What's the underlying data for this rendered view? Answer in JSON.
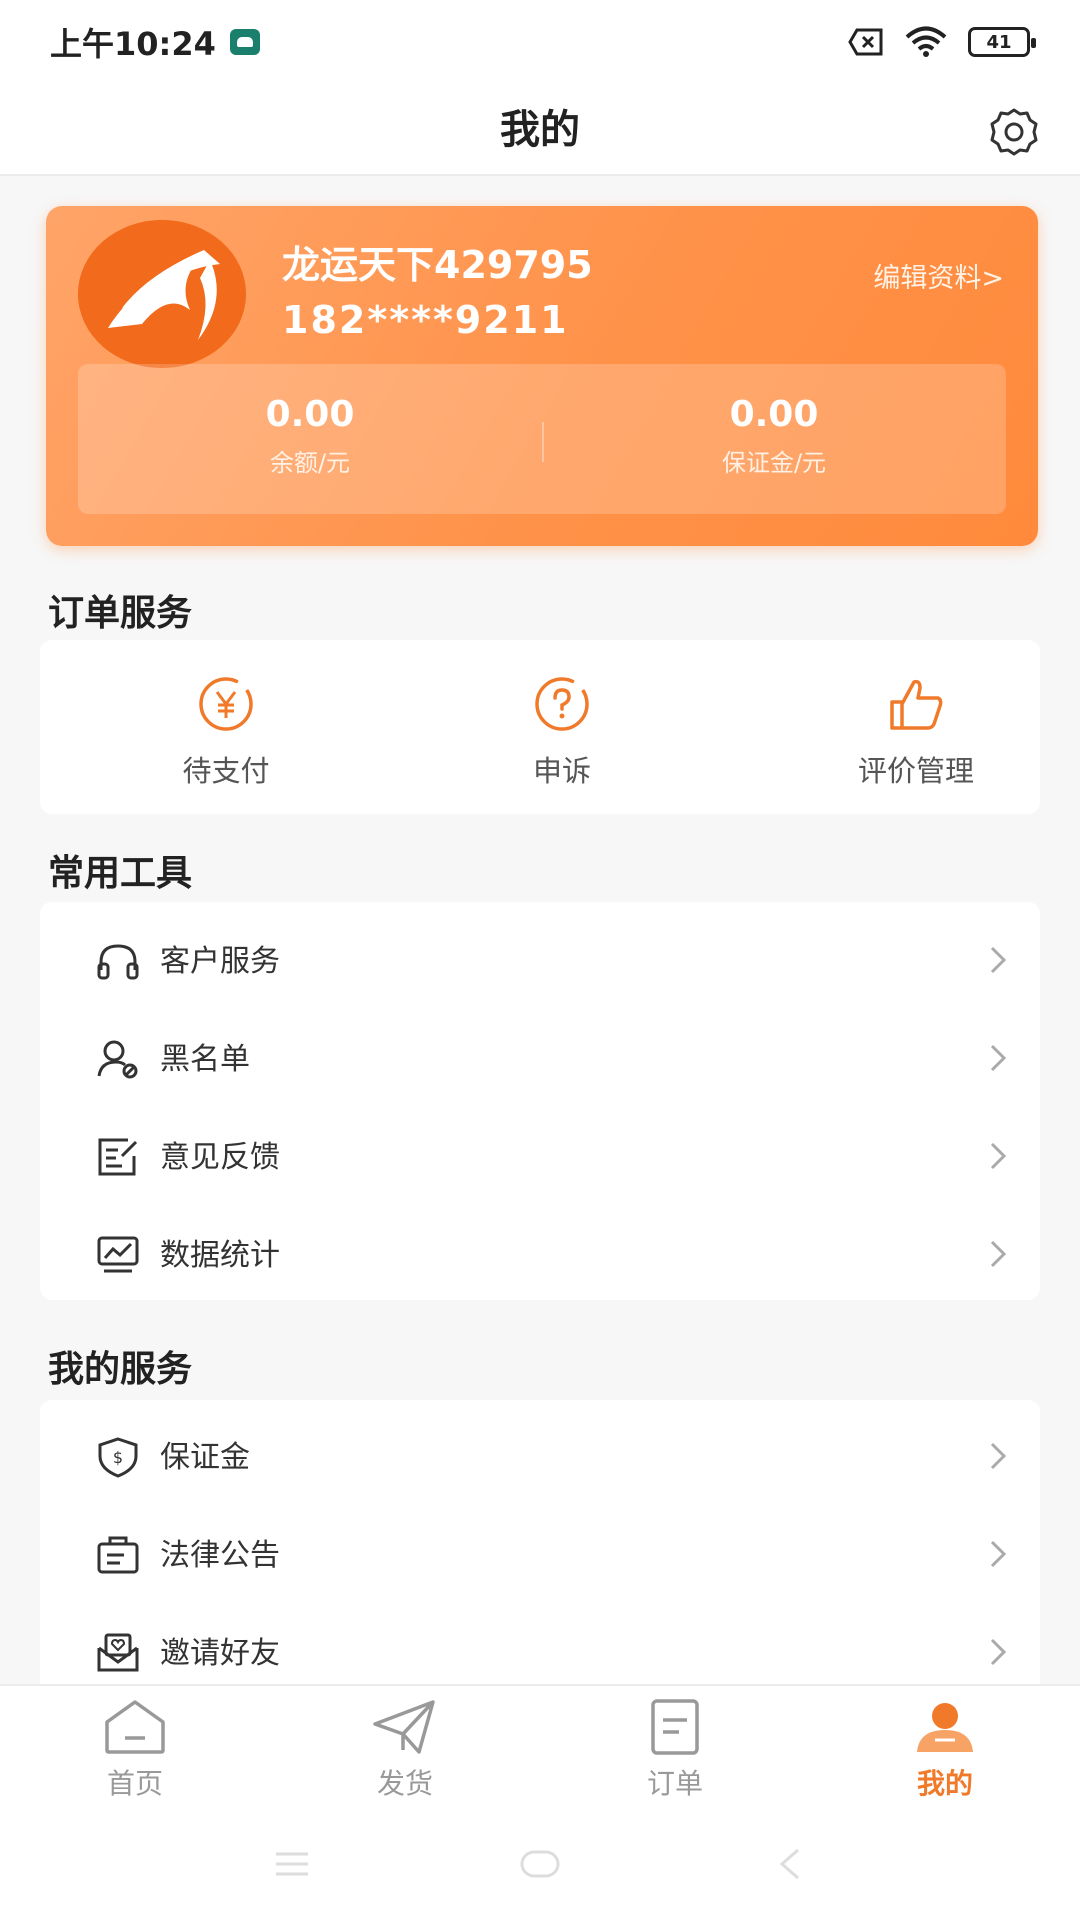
{
  "status_bar": {
    "time": "上午10:24",
    "battery": "41"
  },
  "header": {
    "title": "我的"
  },
  "profile": {
    "name": "龙运天下429795",
    "phone": "182****9211",
    "edit_label": "编辑资料>",
    "balance": {
      "value": "0.00",
      "label": "余额/元"
    },
    "deposit": {
      "value": "0.00",
      "label": "保证金/元"
    }
  },
  "order_service": {
    "title": "订单服务",
    "items": [
      {
        "label": "待支付",
        "icon": "yen-icon"
      },
      {
        "label": "申诉",
        "icon": "question-icon"
      },
      {
        "label": "评价管理",
        "icon": "thumbs-up-icon"
      }
    ]
  },
  "tools": {
    "title": "常用工具",
    "items": [
      {
        "label": "客户服务",
        "icon": "headset-icon"
      },
      {
        "label": "黑名单",
        "icon": "blocked-user-icon"
      },
      {
        "label": "意见反馈",
        "icon": "feedback-icon"
      },
      {
        "label": "数据统计",
        "icon": "chart-icon"
      }
    ]
  },
  "my_service": {
    "title": "我的服务",
    "items": [
      {
        "label": "保证金",
        "icon": "shield-dollar-icon"
      },
      {
        "label": "法律公告",
        "icon": "legal-notice-icon"
      },
      {
        "label": "邀请好友",
        "icon": "invite-icon"
      }
    ]
  },
  "tabs": [
    {
      "label": "首页",
      "icon": "home-icon"
    },
    {
      "label": "发货",
      "icon": "send-icon"
    },
    {
      "label": "订单",
      "icon": "order-icon"
    },
    {
      "label": "我的",
      "icon": "user-icon",
      "active": true
    }
  ],
  "colors": {
    "accent": "#f07a2a",
    "card_start": "#ffa468",
    "card_end": "#ff8a3c"
  }
}
